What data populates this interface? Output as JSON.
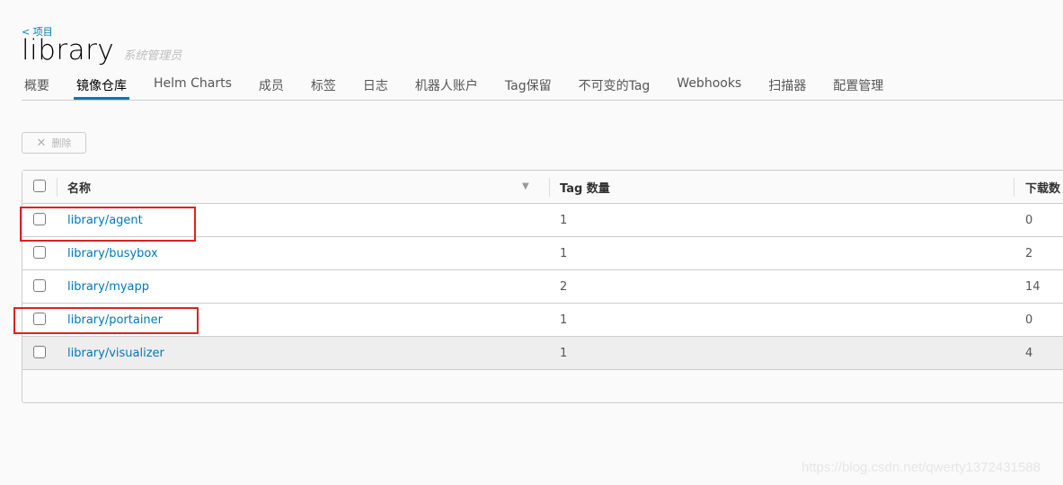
{
  "breadcrumb": {
    "back_label": "< 项目"
  },
  "header": {
    "title": "library",
    "role": "系统管理员"
  },
  "tabs": [
    {
      "label": "概要",
      "active": false
    },
    {
      "label": "镜像仓库",
      "active": true
    },
    {
      "label": "Helm Charts",
      "active": false
    },
    {
      "label": "成员",
      "active": false
    },
    {
      "label": "标签",
      "active": false
    },
    {
      "label": "日志",
      "active": false
    },
    {
      "label": "机器人账户",
      "active": false
    },
    {
      "label": "Tag保留",
      "active": false
    },
    {
      "label": "不可变的Tag",
      "active": false
    },
    {
      "label": "Webhooks",
      "active": false
    },
    {
      "label": "扫描器",
      "active": false
    },
    {
      "label": "配置管理",
      "active": false
    }
  ],
  "toolbar": {
    "delete_label": "删除",
    "delete_icon": "close-icon"
  },
  "table": {
    "columns": {
      "name": "名称",
      "tags": "Tag 数量",
      "pulls": "下载数"
    },
    "rows": [
      {
        "name": "library/agent",
        "tags": "1",
        "pulls": "0",
        "highlighted": true
      },
      {
        "name": "library/busybox",
        "tags": "1",
        "pulls": "2",
        "highlighted": false
      },
      {
        "name": "library/myapp",
        "tags": "2",
        "pulls": "14",
        "highlighted": false
      },
      {
        "name": "library/portainer",
        "tags": "1",
        "pulls": "0",
        "highlighted": true
      },
      {
        "name": "library/visualizer",
        "tags": "1",
        "pulls": "4",
        "highlighted": false,
        "hovered": true
      }
    ]
  },
  "colors": {
    "accent": "#0079b8",
    "annotation": "#e02020"
  },
  "watermark": "https://blog.csdn.net/qwerty1372431588"
}
